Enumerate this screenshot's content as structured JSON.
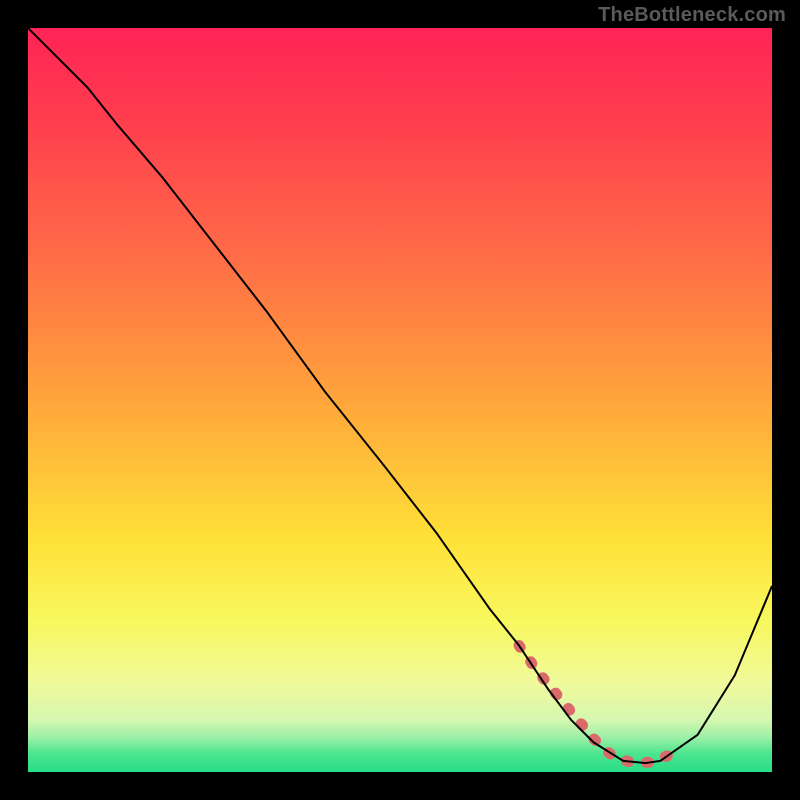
{
  "watermark": "TheBottleneck.com",
  "chart_data": {
    "type": "line",
    "title": "",
    "xlabel": "",
    "ylabel": "",
    "xlim": [
      0,
      100
    ],
    "ylim": [
      0,
      100
    ],
    "grid": false,
    "legend": false,
    "background": {
      "type": "vertical-gradient",
      "stops": [
        {
          "offset": 0.0,
          "color": "#ff2356"
        },
        {
          "offset": 0.13,
          "color": "#ff3f4e"
        },
        {
          "offset": 0.3,
          "color": "#ff6a47"
        },
        {
          "offset": 0.5,
          "color": "#ffa53b"
        },
        {
          "offset": 0.69,
          "color": "#ffe238"
        },
        {
          "offset": 0.8,
          "color": "#f8f860"
        },
        {
          "offset": 0.88,
          "color": "#f0fa9b"
        },
        {
          "offset": 0.93,
          "color": "#d6f7b0"
        },
        {
          "offset": 0.955,
          "color": "#96efa5"
        },
        {
          "offset": 0.975,
          "color": "#4de58f"
        },
        {
          "offset": 1.0,
          "color": "#27dd86"
        }
      ]
    },
    "series": [
      {
        "name": "bottleneck-curve",
        "x": [
          0,
          4,
          8,
          12,
          18,
          25,
          32,
          40,
          48,
          55,
          62,
          66,
          70,
          73,
          76,
          80,
          83,
          85,
          90,
          95,
          100
        ],
        "y": [
          100,
          96,
          92,
          87,
          80,
          71,
          62,
          51,
          41,
          32,
          22,
          17,
          11,
          7,
          4,
          1.5,
          1.2,
          1.5,
          5,
          13,
          25
        ]
      }
    ],
    "annotations": [
      {
        "name": "valley-highlight-dots",
        "style": "round-beads",
        "color": "#da6a6a",
        "x": [
          66,
          68.5,
          71,
          73.5,
          76,
          78.5,
          81,
          83.5,
          86
        ],
        "y": [
          17,
          13.5,
          10.5,
          7.5,
          4.5,
          2.2,
          1.3,
          1.3,
          2.2
        ]
      }
    ]
  }
}
